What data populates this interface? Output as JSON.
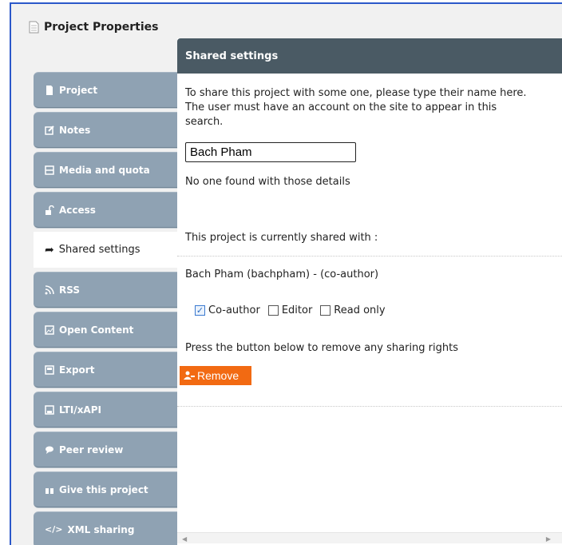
{
  "window": {
    "title": "Project Properties",
    "icon": "document-icon"
  },
  "sidebar": {
    "tabs": [
      {
        "label": "Project",
        "icon": "document-icon"
      },
      {
        "label": "Notes",
        "icon": "edit-icon"
      },
      {
        "label": "Media and quota",
        "icon": "film-icon"
      },
      {
        "label": "Access",
        "icon": "unlock-icon"
      },
      {
        "label": "Shared settings",
        "icon": "share-arrow-icon",
        "active": true
      },
      {
        "label": "RSS",
        "icon": "rss-icon"
      },
      {
        "label": "Open Content",
        "icon": "image-icon"
      },
      {
        "label": "Export",
        "icon": "export-icon"
      },
      {
        "label": "LTI/xAPI",
        "icon": "save-icon"
      },
      {
        "label": "Peer review",
        "icon": "chat-icon"
      },
      {
        "label": "Give this project",
        "icon": "gift-icon"
      },
      {
        "label": "XML sharing",
        "icon": "code-icon"
      }
    ]
  },
  "panel": {
    "header": "Shared settings",
    "intro": "To share this project with some one, please type their name here. The user must have an account on the site to appear in this search.",
    "search_value": "Bach Pham",
    "no_result": "No one found with those details",
    "shared_heading": "This project is currently shared with :",
    "shared_user": "Bach Pham (bachpham) - (co-author)",
    "permissions": [
      {
        "label": "Co-author",
        "checked": true
      },
      {
        "label": "Editor",
        "checked": false
      },
      {
        "label": "Read only",
        "checked": false
      }
    ],
    "remove_hint": "Press the button below to remove any sharing rights",
    "remove_label": "Remove"
  },
  "colors": {
    "tab_bg": "#8fa2b3",
    "header_bg": "#4a5a64",
    "remove_bg": "#f26a12",
    "frame_border": "#2b58c9"
  }
}
